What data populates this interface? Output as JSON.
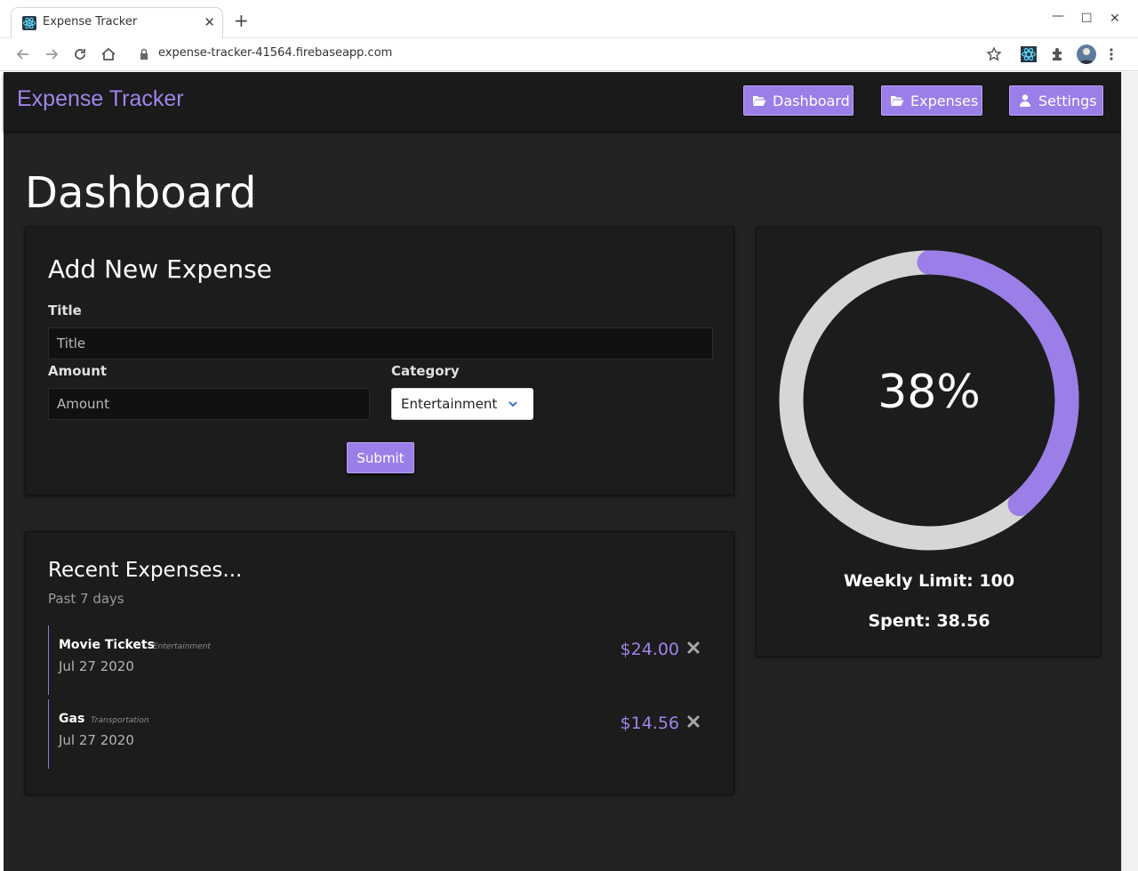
{
  "browser": {
    "tab_title": "Expense Tracker",
    "tab_close": "✕",
    "new_tab": "+",
    "url": "expense-tracker-41564.firebaseapp.com",
    "window_controls": {
      "minimize": "—",
      "maximize": "☐",
      "close": "✕"
    }
  },
  "navbar": {
    "brand": "Expense Tracker",
    "buttons": [
      {
        "label": "Dashboard",
        "icon": "folder-open-icon"
      },
      {
        "label": "Expenses",
        "icon": "folder-open-icon"
      },
      {
        "label": "Settings",
        "icon": "user-icon"
      }
    ]
  },
  "page": {
    "title": "Dashboard"
  },
  "add_expense": {
    "heading": "Add New Expense",
    "title_label": "Title",
    "title_placeholder": "Title",
    "amount_label": "Amount",
    "amount_placeholder": "Amount",
    "category_label": "Category",
    "category_selected": "Entertainment",
    "submit_label": "Submit"
  },
  "recent": {
    "heading": "Recent Expenses...",
    "subheading": "Past 7 days",
    "items": [
      {
        "name": "Movie Tickets",
        "category": "Entertainment",
        "date": "Jul 27 2020",
        "amount": "$24.00"
      },
      {
        "name": "Gas",
        "category": "Transportation",
        "date": "Jul 27 2020",
        "amount": "$14.56"
      }
    ]
  },
  "stats": {
    "percent_label": "38%",
    "percent_value": 0.3856,
    "weekly_limit": "Weekly Limit: 100",
    "spent": "Spent: 38.56"
  },
  "colors": {
    "accent": "#9b7ee8",
    "brand_text": "#a084e8",
    "background": "#232323",
    "panel": "#1c1c1c",
    "ring_track": "#d6d6d6"
  }
}
